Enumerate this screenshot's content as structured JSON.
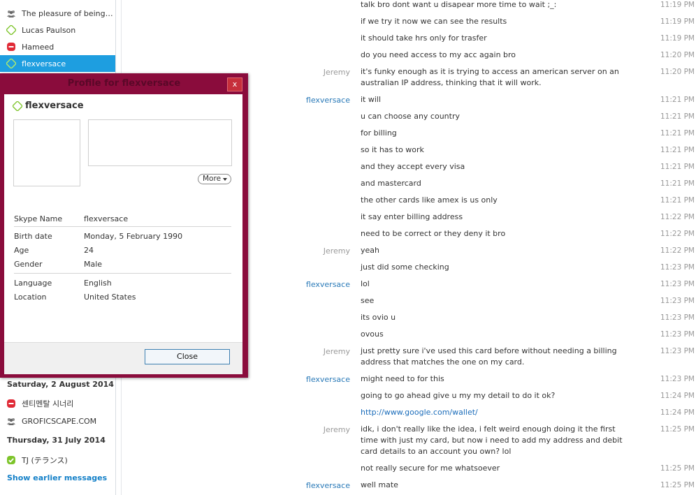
{
  "sidebar": {
    "items": [
      {
        "label": "The pleasure of being cu...",
        "icon": "group-icon",
        "status": "group"
      },
      {
        "label": "Lucas Paulson",
        "icon": "status-offline-icon",
        "status": "offline"
      },
      {
        "label": "Hameed",
        "icon": "status-dnd-icon",
        "status": "busy"
      },
      {
        "label": "flexversace",
        "icon": "status-offline-icon",
        "status": "offline",
        "selected": true
      }
    ],
    "date_1": "Saturday, 2 August 2014",
    "items_2": [
      {
        "label": "센티멘탈 시너리",
        "icon": "status-dnd-icon"
      },
      {
        "label": "GROFICSCAPE.COM",
        "icon": "group-icon"
      }
    ],
    "date_2": "Thursday, 31 July 2014",
    "items_3": [
      {
        "label": "TJ (テランス)",
        "icon": "status-online-icon"
      }
    ],
    "show_earlier": "Show earlier messages"
  },
  "profile": {
    "title": "Profile for flexversace",
    "close_x": "x",
    "name": "flexversace",
    "more_label": "More",
    "fields": {
      "skype_name_label": "Skype Name",
      "skype_name": "flexversace",
      "birth_label": "Birth date",
      "birth": "Monday, 5 February 1990",
      "age_label": "Age",
      "age": "24",
      "gender_label": "Gender",
      "gender": "Male",
      "language_label": "Language",
      "language": "English",
      "location_label": "Location",
      "location": "United States"
    },
    "close_button": "Close"
  },
  "messages": [
    {
      "sender": "",
      "text": "talk bro dont want u disapear more time to wait ;_:",
      "time": "11:19 PM"
    },
    {
      "sender": "",
      "text": "if we try it now we can see the results",
      "time": "11:19 PM"
    },
    {
      "sender": "",
      "text": "it should take hrs only for trasfer",
      "time": "11:19 PM"
    },
    {
      "sender": "",
      "text": "do you need access to my acc again bro",
      "time": "11:20 PM"
    },
    {
      "sender": "Jeremy",
      "text": "it's funky enough as it is trying to access an american server on an australian IP address, thinking that it will work.",
      "time": "11:20 PM"
    },
    {
      "sender": "flexversace",
      "text": "it will",
      "time": "11:21 PM"
    },
    {
      "sender": "",
      "text": "u can choose any country",
      "time": "11:21 PM"
    },
    {
      "sender": "",
      "text": "for billing",
      "time": "11:21 PM"
    },
    {
      "sender": "",
      "text": "so it has to work",
      "time": "11:21 PM"
    },
    {
      "sender": "",
      "text": "and they accept every visa",
      "time": "11:21 PM"
    },
    {
      "sender": "",
      "text": "and mastercard",
      "time": "11:21 PM"
    },
    {
      "sender": "",
      "text": "the other cards like amex is us only",
      "time": "11:21 PM"
    },
    {
      "sender": "",
      "text": "it say enter billing address",
      "time": "11:22 PM"
    },
    {
      "sender": "",
      "text": "need to be correct or they deny it bro",
      "time": "11:22 PM"
    },
    {
      "sender": "Jeremy",
      "text": "yeah",
      "time": "11:22 PM"
    },
    {
      "sender": "",
      "text": "just did some checking",
      "time": "11:23 PM"
    },
    {
      "sender": "flexversace",
      "text": "lol",
      "time": "11:23 PM"
    },
    {
      "sender": "",
      "text": "see",
      "time": "11:23 PM"
    },
    {
      "sender": "",
      "text": "its ovio u",
      "time": "11:23 PM"
    },
    {
      "sender": "",
      "text": "ovous",
      "time": "11:23 PM"
    },
    {
      "sender": "Jeremy",
      "text": "just pretty sure i've used this card before without needing a billing address that matches the one on my card.",
      "time": "11:23 PM"
    },
    {
      "sender": "flexversace",
      "text": "might need to for this",
      "time": "11:23 PM"
    },
    {
      "sender": "",
      "text": "going to go ahead give u my my detail to do it ok?",
      "time": "11:24 PM"
    },
    {
      "sender": "",
      "text": "http://www.google.com/wallet/",
      "time": "11:24 PM",
      "link": true
    },
    {
      "sender": "Jeremy",
      "text": "idk, i don't really like the idea, i felt weird enough doing it the first time with just my card, but now i need to add my address and debit card details to an account you own? lol",
      "time": "11:25 PM"
    },
    {
      "sender": "",
      "text": "not really secure for me whatsoever",
      "time": "11:25 PM"
    },
    {
      "sender": "flexversace",
      "text": "well mate",
      "time": "11:25 PM"
    }
  ]
}
